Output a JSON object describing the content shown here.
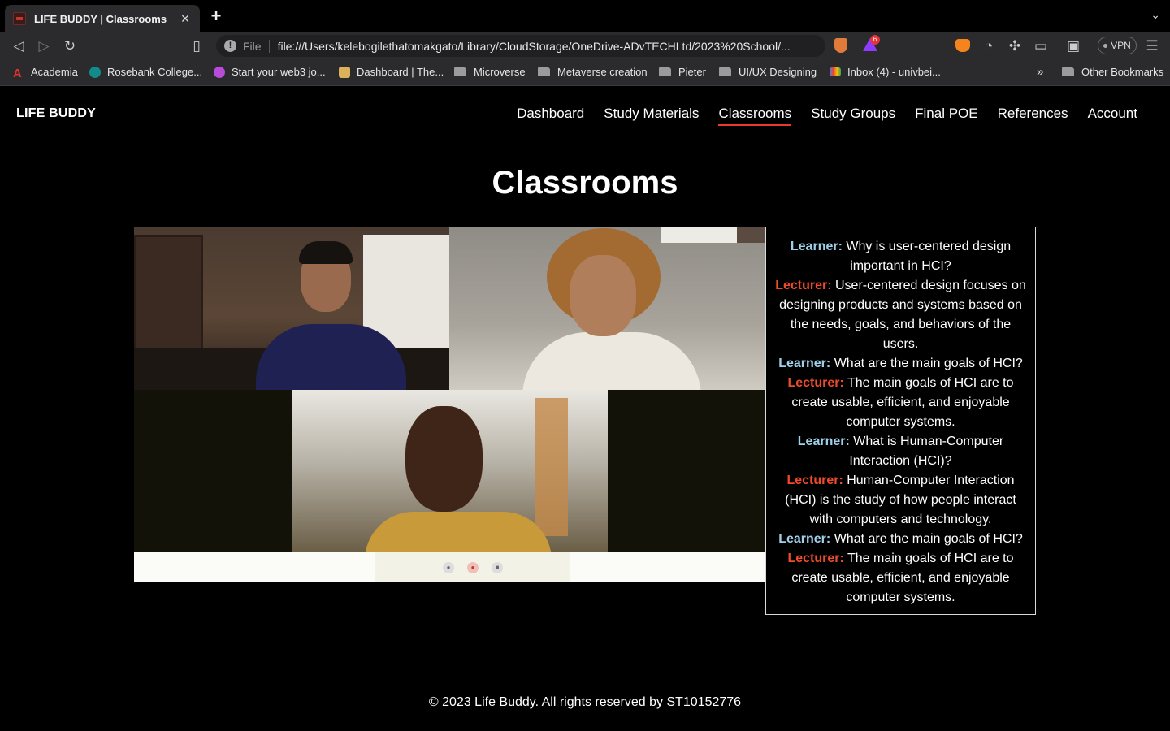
{
  "browser": {
    "tab_title": "LIFE BUDDY | Classrooms",
    "tab_close": "×",
    "new_tab": "+",
    "url_scheme": "File",
    "url": "file:///Users/kelebogilethatomakgato/Library/CloudStorage/OneDrive-ADvTECHLtd/2023%20School/...",
    "rewards_badge": "6",
    "vpn_label": "VPN",
    "bookmarks": [
      {
        "label": "Academia",
        "icon": "academia-icon"
      },
      {
        "label": "Rosebank College...",
        "icon": "sharepoint-icon"
      },
      {
        "label": "Start your web3 jo...",
        "icon": "web3-icon"
      },
      {
        "label": "Dashboard | The...",
        "icon": "dashboard-icon"
      },
      {
        "label": "Microverse",
        "icon": "folder-icon"
      },
      {
        "label": "Metaverse creation",
        "icon": "folder-icon"
      },
      {
        "label": "Pieter",
        "icon": "folder-icon"
      },
      {
        "label": "UI/UX Designing",
        "icon": "folder-icon"
      },
      {
        "label": "Inbox (4) - univbei...",
        "icon": "gmail-icon"
      }
    ],
    "more_bookmarks": "»",
    "other_bookmarks": "Other Bookmarks"
  },
  "site": {
    "logo": "LIFE BUDDY",
    "nav": [
      "Dashboard",
      "Study Materials",
      "Classrooms",
      "Study Groups",
      "Final POE",
      "References",
      "Account"
    ],
    "active_nav": "Classrooms",
    "page_title": "Classrooms",
    "transcript": [
      {
        "speaker": "Learner:",
        "role": "learner",
        "text": "Why is user-centered design important in HCI?"
      },
      {
        "speaker": "Lecturer:",
        "role": "lecturer",
        "text": "User-centered design focuses on designing products and systems based on the needs, goals, and behaviors of the users."
      },
      {
        "speaker": "Learner:",
        "role": "learner",
        "text": "What are the main goals of HCI?"
      },
      {
        "speaker": "Lecturer:",
        "role": "lecturer",
        "text": "The main goals of HCI are to create usable, efficient, and enjoyable computer systems."
      },
      {
        "speaker": "Learner:",
        "role": "learner",
        "text": "What is Human-Computer Interaction (HCI)?"
      },
      {
        "speaker": "Lecturer:",
        "role": "lecturer",
        "text": "Human-Computer Interaction (HCI) is the study of how people interact with computers and technology."
      },
      {
        "speaker": "Learner:",
        "role": "learner",
        "text": "What are the main goals of HCI?"
      },
      {
        "speaker": "Lecturer:",
        "role": "lecturer",
        "text": "The main goals of HCI are to create usable, efficient, and enjoyable computer systems."
      }
    ],
    "footer": "© 2023 Life Buddy. All rights reserved by ST10152776"
  },
  "colors": {
    "learner": "#9fd0ea",
    "lecturer": "#ef4a2a",
    "nav_active_underline": "#e8392f"
  }
}
